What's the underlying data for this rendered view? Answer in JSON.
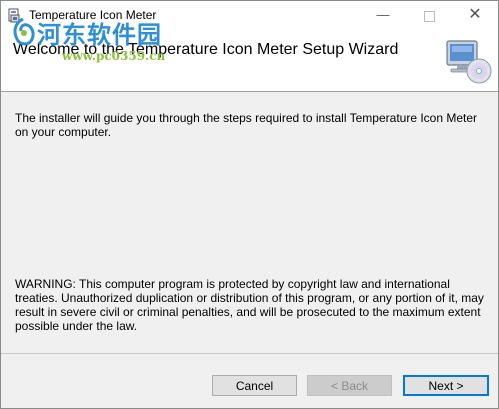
{
  "window": {
    "title": "Temperature Icon Meter",
    "controls": {
      "minimize": "—",
      "close": "✕"
    }
  },
  "header": {
    "title": "Welcome to the Temperature Icon Meter Setup Wizard",
    "icon": "computer-cd-icon"
  },
  "watermark": {
    "text": "河东软件园",
    "url": "www.pc0359.cn"
  },
  "body": {
    "intro": "The installer will guide you through the steps required to install Temperature Icon Meter on your computer.",
    "warning": "WARNING: This computer program is protected by copyright law and international treaties. Unauthorized duplication or distribution of this program, or any portion of it, may result in severe civil or criminal penalties, and will be prosecuted to the maximum extent possible under the law."
  },
  "buttons": {
    "cancel": "Cancel",
    "back": "< Back",
    "next": "Next >"
  },
  "colors": {
    "accent": "#0078d7",
    "watermark_blue": "#2e8ed6",
    "watermark_green": "#8bbf3c"
  }
}
